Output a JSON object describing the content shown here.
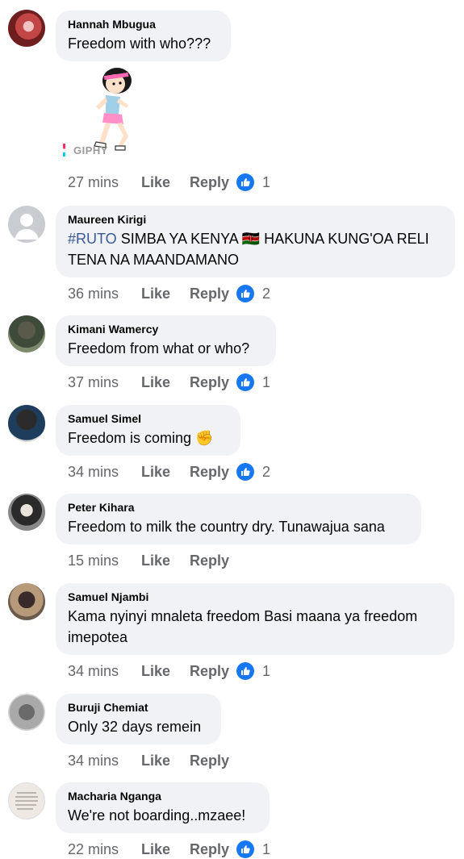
{
  "comments": [
    {
      "author": "Hannah Mbugua",
      "text": "Freedom with who???",
      "time": "27 mins",
      "like": "Like",
      "reply": "Reply",
      "reactions": "1",
      "gif_label": "GIPHY",
      "avatar_color": "#8a2b2b"
    },
    {
      "author": "Maureen Kirigi",
      "hashtag": "#RUTO",
      "text": " SIMBA YA KENYA 🇰🇪 HAKUNA KUNG'OA RELI TENA NA MAANDAMANO",
      "time": "36 mins",
      "like": "Like",
      "reply": "Reply",
      "reactions": "2"
    },
    {
      "author": "Kimani Wamercy",
      "text": "Freedom from what or who?",
      "time": "37 mins",
      "like": "Like",
      "reply": "Reply",
      "reactions": "1"
    },
    {
      "author": "Samuel Simel",
      "text": "Freedom is coming ✊",
      "time": "34 mins",
      "like": "Like",
      "reply": "Reply",
      "reactions": "2"
    },
    {
      "author": "Peter Kihara",
      "text": "Freedom to milk the country dry. Tunawajua sana",
      "time": "15 mins",
      "like": "Like",
      "reply": "Reply"
    },
    {
      "author": "Samuel Njambi",
      "text": "Kama nyinyi mnaleta freedom Basi maana ya freedom imepotea",
      "time": "34 mins",
      "like": "Like",
      "reply": "Reply",
      "reactions": "1"
    },
    {
      "author": "Buruji Chemiat",
      "text": "Only 32 days remein",
      "time": "34 mins",
      "like": "Like",
      "reply": "Reply"
    },
    {
      "author": "Macharia Nganga",
      "text": "We're not boarding..mzaee!",
      "time": "22 mins",
      "like": "Like",
      "reply": "Reply",
      "reactions": "1"
    }
  ],
  "colors": {
    "bubble": "#f0f2f5",
    "meta": "#65676b",
    "like_badge": "#1877f2",
    "hashtag": "#385898"
  },
  "icons": {
    "reaction": "thumbs-up-icon",
    "gif_sticker": "running-girl-sticker"
  }
}
